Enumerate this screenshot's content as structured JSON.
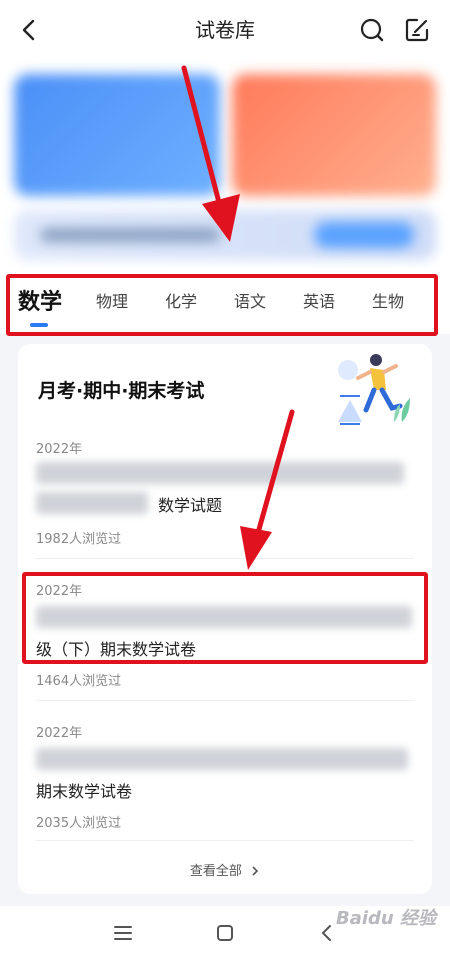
{
  "header": {
    "title": "试卷库",
    "back_icon": "chevron-left-icon",
    "search_icon": "search-icon",
    "edit_icon": "edit-icon"
  },
  "subjects": {
    "items": [
      "数学",
      "物理",
      "化学",
      "语文",
      "英语",
      "生物"
    ],
    "active_index": 0,
    "accent_color": "#2a7bf6"
  },
  "card": {
    "title": "月考·期中·期末考试",
    "items": [
      {
        "year": "2022年",
        "title_visible": "数学试题",
        "views": "1982人浏览过"
      },
      {
        "year": "2022年",
        "title_visible": "级（下）期末数学试卷",
        "views": "1464人浏览过"
      },
      {
        "year": "2022年",
        "title_visible": "期末数学试卷",
        "views": "2035人浏览过"
      }
    ],
    "view_all_label": "查看全部"
  },
  "annotation": {
    "highlight_color": "#e0121f"
  },
  "navbar": {
    "menu_icon": "menu-icon",
    "home_icon": "home-square-icon",
    "back_icon": "back-triangle-icon"
  },
  "watermark": {
    "text": "Baidu 经验"
  }
}
